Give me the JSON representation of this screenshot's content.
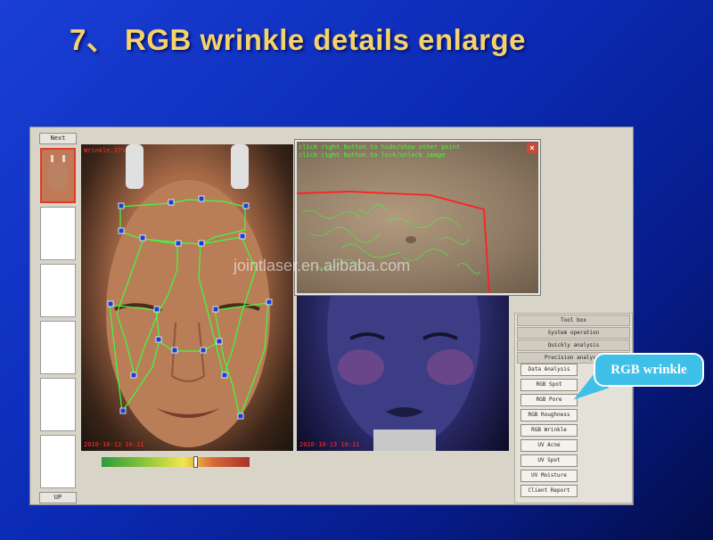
{
  "slide": {
    "title": "7、 RGB wrinkle details enlarge"
  },
  "app": {
    "strip": {
      "next_label": "Next",
      "up_label": "UP"
    },
    "left_panel": {
      "top_stamp": "Wrinkle:37%",
      "bottom_stamp": "2010-10-13 10:11"
    },
    "right_panel": {
      "bottom_stamp": "2010-10-13 10:11"
    },
    "popup": {
      "hint_1": "click right button to hide/show other point",
      "hint_2": "click right button to lock/unlock image",
      "close_label": "×"
    },
    "color_scale": {
      "marker_value": 0.64
    },
    "toolbox": {
      "headers": [
        "Tool box",
        "System operation",
        "Quickly analysis",
        "Precision analysis"
      ],
      "buttons": [
        "Data Analysis",
        "RGB Spot",
        "RGB Pore",
        "RGB Roughness",
        "RGB Wrinkle",
        "UV Acne",
        "UV Spot",
        "UV Moisture",
        "Client Report"
      ]
    }
  },
  "watermark": "jointlaser.en.alibaba.com",
  "callout": {
    "label": "RGB wrinkle"
  },
  "colors": {
    "title": "#f5d36a",
    "callout": "#3fc0e8",
    "overlay_lines": "#3cff3c",
    "points": "#1a3fd6"
  }
}
